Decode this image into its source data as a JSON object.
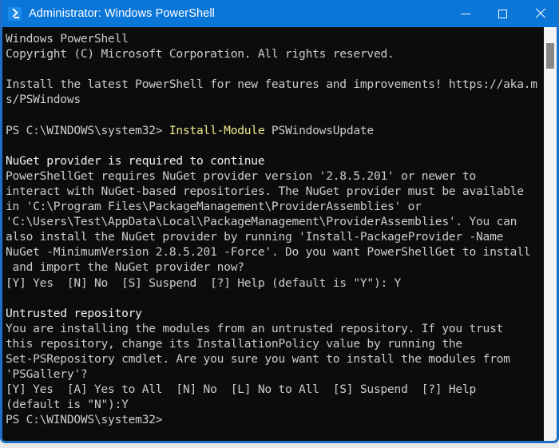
{
  "window": {
    "title": "Administrator: Windows PowerShell",
    "icon": "powershell-prompt-icon",
    "titlebar_color": "#0a76d8",
    "border_color": "#1f6fc4",
    "background_color": "#0c0c0c",
    "controls": {
      "minimize": "minimize-icon",
      "maximize": "maximize-icon",
      "close": "close-icon"
    }
  },
  "console": {
    "foreground_color": "#cccccc",
    "bright_color": "#f2f2f2",
    "cmdlet_color": "#efe98c",
    "lines": [
      {
        "id": "l01",
        "text": "Windows PowerShell"
      },
      {
        "id": "l02",
        "text": "Copyright (C) Microsoft Corporation. All rights reserved."
      },
      {
        "id": "l03",
        "text": ""
      },
      {
        "id": "l04",
        "text": "Install the latest PowerShell for new features and improvements! https://aka.m"
      },
      {
        "id": "l05",
        "text": "s/PSWindows"
      },
      {
        "id": "l06",
        "text": ""
      },
      {
        "id": "l07",
        "prompt": "PS C:\\WINDOWS\\system32> ",
        "cmdlet": "Install-Module",
        "args": " PSWindowsUpdate"
      },
      {
        "id": "l08",
        "text": ""
      },
      {
        "id": "l09",
        "text": "NuGet provider is required to continue",
        "style": "bright"
      },
      {
        "id": "l10",
        "text": "PowerShellGet requires NuGet provider version '2.8.5.201' or newer to"
      },
      {
        "id": "l11",
        "text": "interact with NuGet-based repositories. The NuGet provider must be available"
      },
      {
        "id": "l12",
        "text": "in 'C:\\Program Files\\PackageManagement\\ProviderAssemblies' or"
      },
      {
        "id": "l13",
        "text": "'C:\\Users\\Test\\AppData\\Local\\PackageManagement\\ProviderAssemblies'. You can"
      },
      {
        "id": "l14",
        "text": "also install the NuGet provider by running 'Install-PackageProvider -Name"
      },
      {
        "id": "l15",
        "text": "NuGet -MinimumVersion 2.8.5.201 -Force'. Do you want PowerShellGet to install"
      },
      {
        "id": "l16",
        "text": " and import the NuGet provider now?"
      },
      {
        "id": "l17",
        "text": "[Y] Yes  [N] No  [S] Suspend  [?] Help (default is \"Y\"): Y"
      },
      {
        "id": "l18",
        "text": ""
      },
      {
        "id": "l19",
        "text": "Untrusted repository",
        "style": "bright"
      },
      {
        "id": "l20",
        "text": "You are installing the modules from an untrusted repository. If you trust"
      },
      {
        "id": "l21",
        "text": "this repository, change its InstallationPolicy value by running the"
      },
      {
        "id": "l22",
        "text": "Set-PSRepository cmdlet. Are you sure you want to install the modules from"
      },
      {
        "id": "l23",
        "text": "'PSGallery'?"
      },
      {
        "id": "l24",
        "text": "[Y] Yes  [A] Yes to All  [N] No  [L] No to All  [S] Suspend  [?] Help"
      },
      {
        "id": "l25",
        "text": "(default is \"N\"):Y"
      },
      {
        "id": "l26",
        "text": "PS C:\\WINDOWS\\system32>"
      }
    ]
  },
  "scrollbar": {
    "name": "vertical-scrollbar",
    "thumb_name": "scrollbar-thumb"
  }
}
